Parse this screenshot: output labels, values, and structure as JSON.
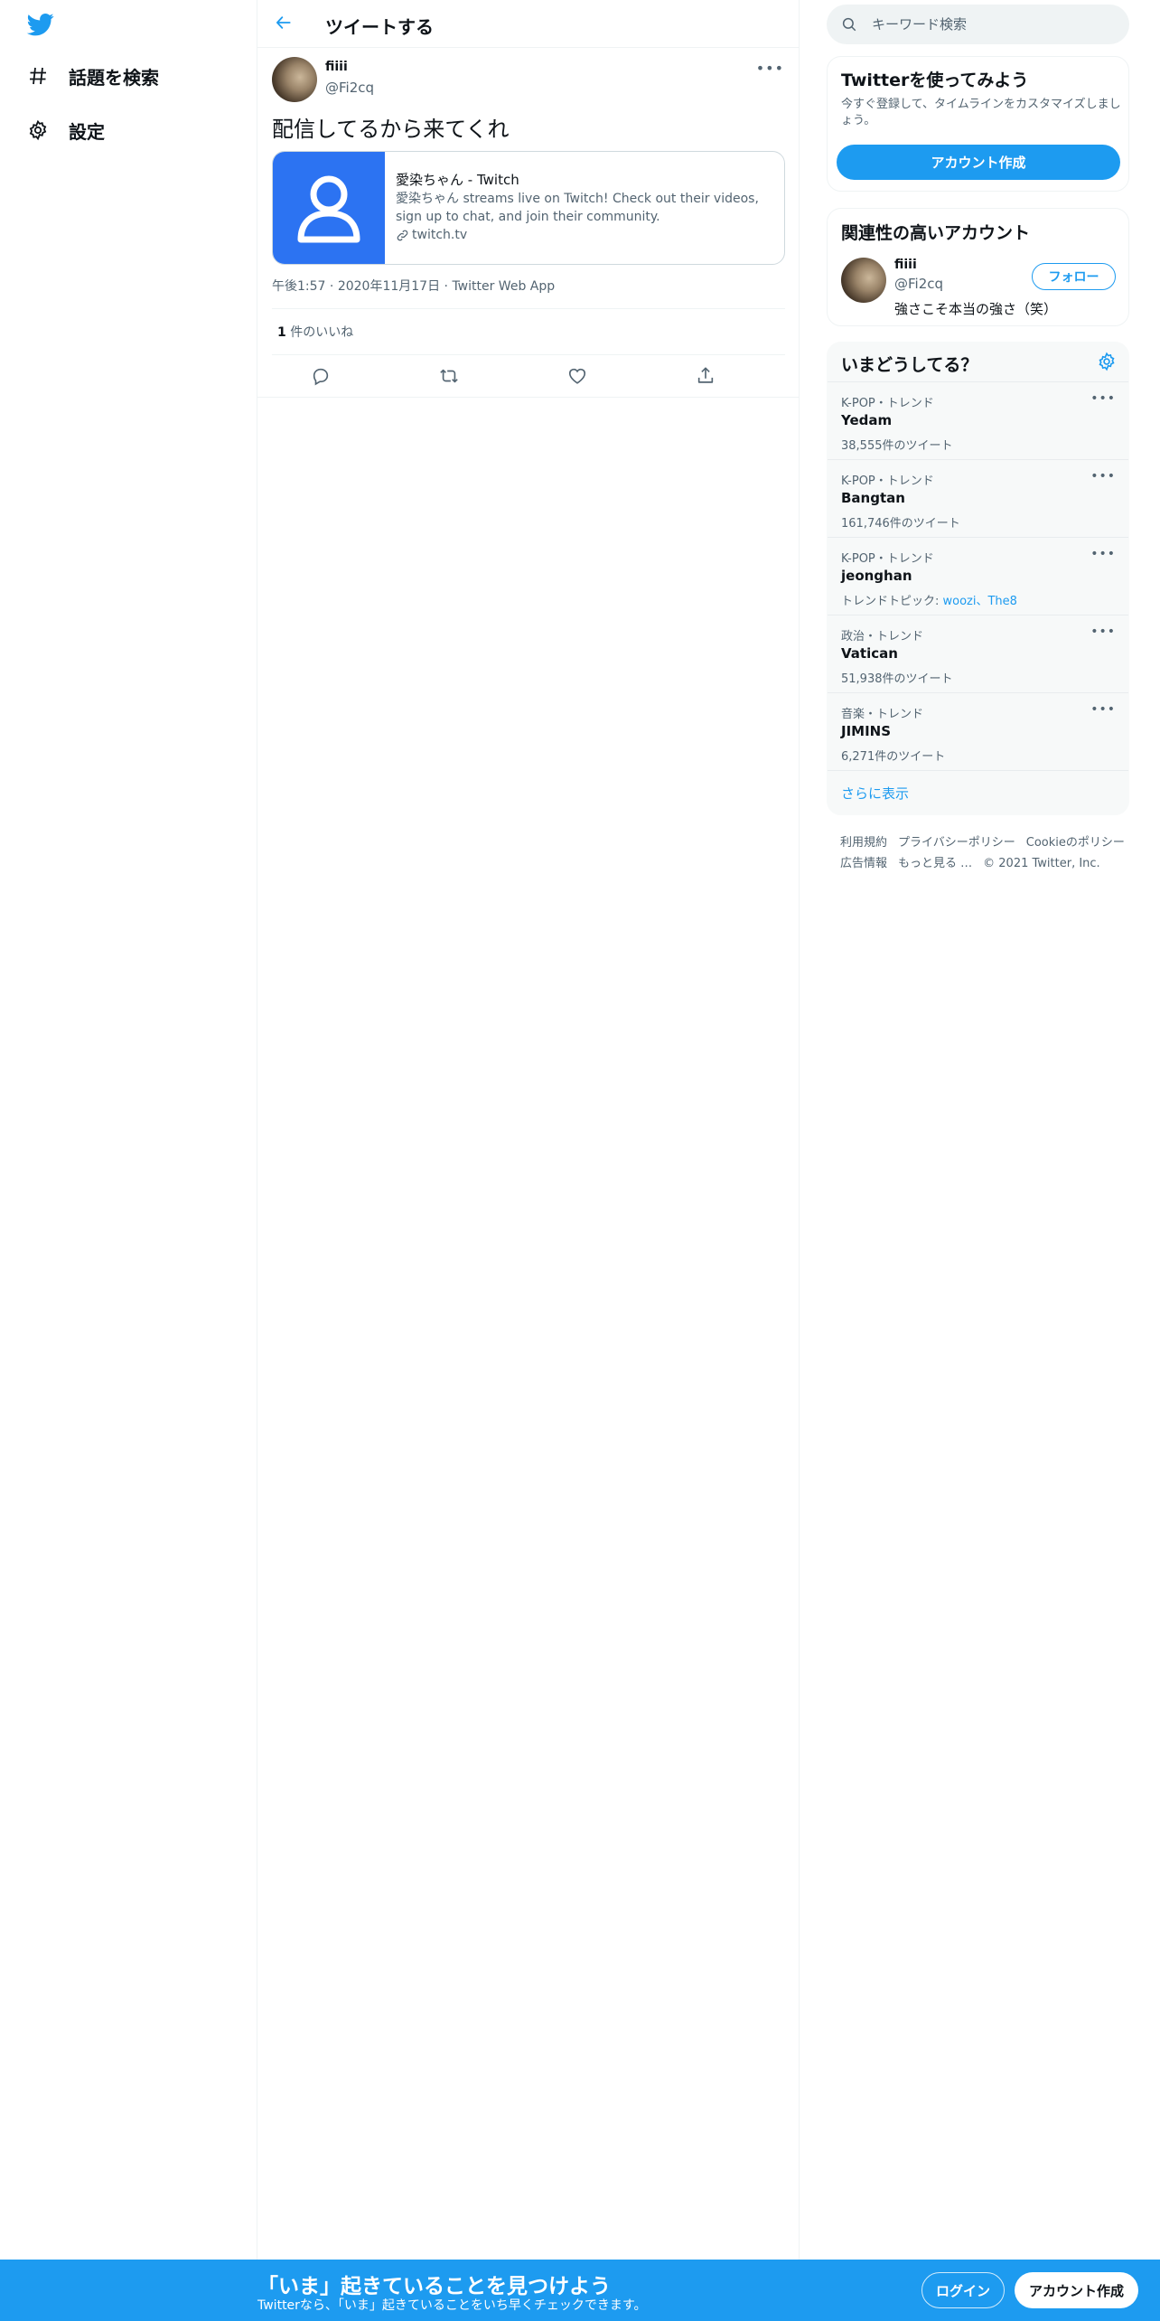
{
  "nav": {
    "items": [
      {
        "label": "話題を検索",
        "icon": "hashtag-icon"
      },
      {
        "label": "設定",
        "icon": "gear-icon"
      }
    ]
  },
  "main": {
    "header_title": "ツイートする",
    "tweet": {
      "name": "fiiii",
      "handle": "@Fi2cq",
      "text": "配信してるから来てくれ",
      "card": {
        "title": "愛染ちゃん - Twitch",
        "description": "愛染ちゃん streams live on Twitch! Check out their videos, sign up to chat, and join their community.",
        "domain": "twitch.tv"
      },
      "time": "午後1:57",
      "date": "2020年11月17日",
      "source": "Twitter Web App",
      "like_count": "1",
      "like_label": " 件のいいね"
    }
  },
  "right": {
    "search_placeholder": "キーワード検索",
    "signup_panel": {
      "title": "Twitterを使ってみよう",
      "subtitle": "今すぐ登録して、タイムラインをカスタマイズしましょう。",
      "button": "アカウント作成"
    },
    "related": {
      "title": "関連性の高いアカウント",
      "name": "fiiii",
      "handle": "@Fi2cq",
      "bio": "強さこそ本当の強さ（笑）",
      "follow": "フォロー"
    },
    "trends": {
      "title": "いまどうしてる？",
      "items": [
        {
          "context": "K-POP・トレンド",
          "name": "Yedam",
          "count": "38,555件のツイート"
        },
        {
          "context": "K-POP・トレンド",
          "name": "Bangtan",
          "count": "161,746件のツイート"
        },
        {
          "context": "K-POP・トレンド",
          "name": "jeonghan",
          "count_prefix": "トレンドトピック: ",
          "count_links": "woozi、The8"
        },
        {
          "context": "政治・トレンド",
          "name": "Vatican",
          "count": "51,938件のツイート"
        },
        {
          "context": "音楽・トレンド",
          "name": "JIMINS",
          "count": "6,271件のツイート"
        }
      ],
      "show_more": "さらに表示"
    },
    "footer": {
      "links1": [
        "利用規約",
        "プライバシーポリシー",
        "Cookieのポリシー"
      ],
      "links2": [
        "広告情報",
        "もっと見る …"
      ],
      "copyright": "© 2021 Twitter, Inc."
    }
  },
  "bottom_bar": {
    "title": "「いま」起きていることを見つけよう",
    "subtitle": "Twitterなら、「いま」起きていることをいち早くチェックできます。",
    "login": "ログイン",
    "signup": "アカウント作成"
  },
  "colors": {
    "brand": "#1d9bf0",
    "card_thumb": "#2c73f2",
    "text": "#0f1419",
    "secondary": "#536471"
  }
}
